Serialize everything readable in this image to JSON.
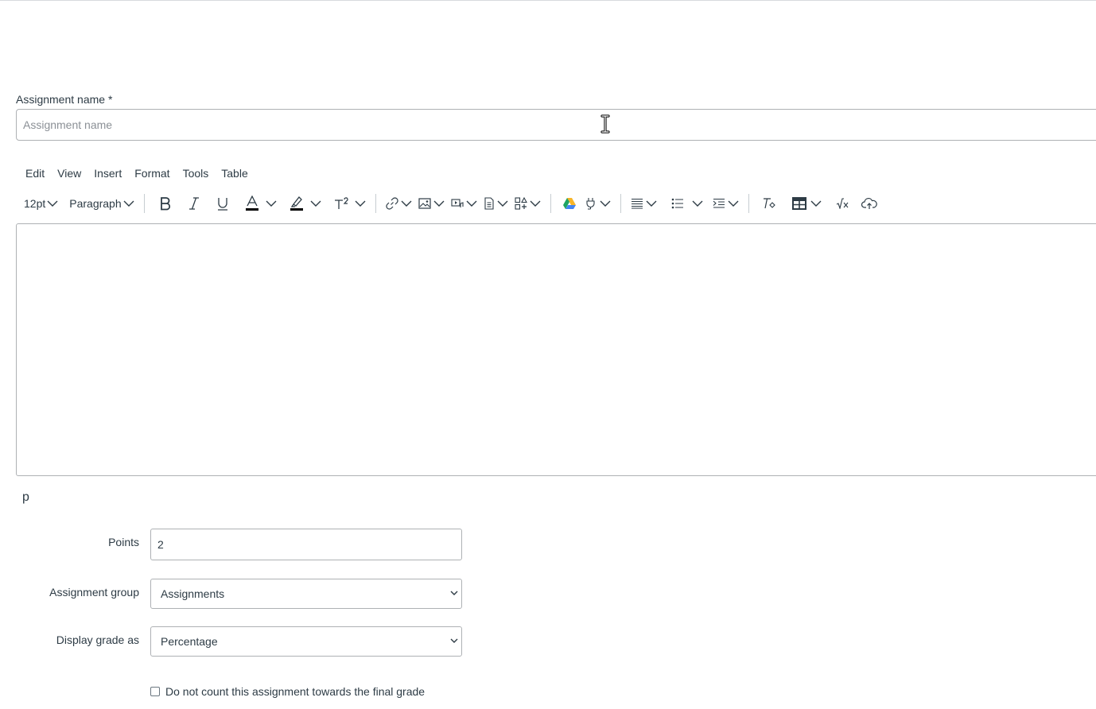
{
  "form": {
    "assignment_name_label": "Assignment name *",
    "assignment_name_placeholder": "Assignment name",
    "assignment_name_value": ""
  },
  "editor": {
    "menu": [
      "Edit",
      "View",
      "Insert",
      "Format",
      "Tools",
      "Table"
    ],
    "font_size": "12pt",
    "block_format": "Paragraph",
    "toolbar_icons": [
      "bold-icon",
      "italic-icon",
      "underline-icon",
      "text-color-icon",
      "highlight-color-icon",
      "superscript-icon",
      "link-icon",
      "image-icon",
      "media-icon",
      "document-icon",
      "apps-icon",
      "google-drive-icon",
      "plugin-icon",
      "align-icon",
      "bullet-list-icon",
      "indent-icon",
      "clear-formatting-icon",
      "table-icon",
      "equation-icon",
      "cloud-upload-icon"
    ],
    "path_indicator": "p",
    "text_color": "#000000",
    "highlight_color": "#000000"
  },
  "points": {
    "label": "Points",
    "value": "2"
  },
  "assignment_group": {
    "label": "Assignment group",
    "selected": "Assignments"
  },
  "display_grade": {
    "label": "Display grade as",
    "selected": "Percentage"
  },
  "omit_from_final_grade": {
    "label": "Do not count this assignment towards the final grade",
    "checked": false
  }
}
